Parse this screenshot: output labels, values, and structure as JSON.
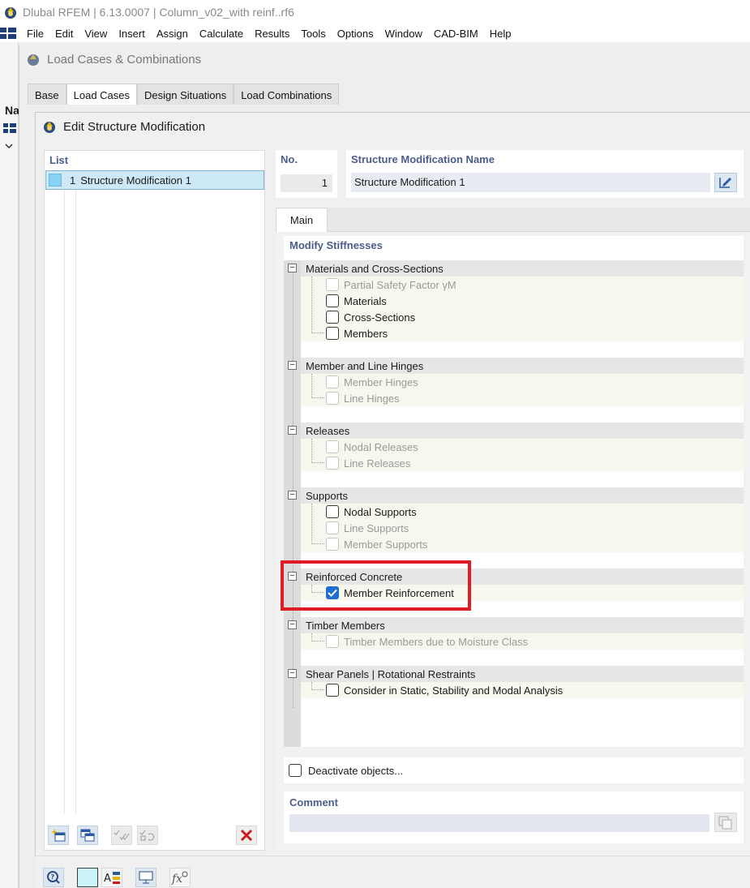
{
  "app": {
    "title": "Dlubal RFEM | 6.13.0007 | Column_v02_with reinf..rf6",
    "nav_label": "Na"
  },
  "menu": [
    "File",
    "Edit",
    "View",
    "Insert",
    "Assign",
    "Calculate",
    "Results",
    "Tools",
    "Options",
    "Window",
    "CAD-BIM",
    "Help"
  ],
  "load_cases_dialog": {
    "title": "Load Cases & Combinations",
    "tabs": [
      "Base",
      "Load Cases",
      "Design Situations",
      "Load Combinations"
    ],
    "active_tab": "Load Cases"
  },
  "edit_dialog": {
    "title": "Edit Structure Modification",
    "list_header": "List",
    "list_items": [
      {
        "num": "1",
        "label": "Structure Modification 1"
      }
    ],
    "no_header": "No.",
    "no_value": "1",
    "name_header": "Structure Modification Name",
    "name_value": "Structure Modification 1",
    "main_tab": "Main",
    "modify_header": "Modify Stiffnesses",
    "groups": [
      {
        "label": "Materials and Cross-Sections",
        "items": [
          {
            "label": "Partial Safety Factor γM",
            "enabled": false,
            "checked": false
          },
          {
            "label": "Materials",
            "enabled": true,
            "checked": false
          },
          {
            "label": "Cross-Sections",
            "enabled": true,
            "checked": false
          },
          {
            "label": "Members",
            "enabled": true,
            "checked": false
          }
        ]
      },
      {
        "label": "Member and Line Hinges",
        "items": [
          {
            "label": "Member Hinges",
            "enabled": false,
            "checked": false
          },
          {
            "label": "Line Hinges",
            "enabled": false,
            "checked": false
          }
        ]
      },
      {
        "label": "Releases",
        "items": [
          {
            "label": "Nodal Releases",
            "enabled": false,
            "checked": false
          },
          {
            "label": "Line Releases",
            "enabled": false,
            "checked": false
          }
        ]
      },
      {
        "label": "Supports",
        "items": [
          {
            "label": "Nodal Supports",
            "enabled": true,
            "checked": false
          },
          {
            "label": "Line Supports",
            "enabled": false,
            "checked": false
          },
          {
            "label": "Member Supports",
            "enabled": false,
            "checked": false
          }
        ]
      },
      {
        "label": "Reinforced Concrete",
        "items": [
          {
            "label": "Member Reinforcement",
            "enabled": true,
            "checked": true
          }
        ]
      },
      {
        "label": "Timber Members",
        "items": [
          {
            "label": "Timber Members due to Moisture Class",
            "enabled": false,
            "checked": false
          }
        ]
      },
      {
        "label": "Shear Panels | Rotational Restraints",
        "items": [
          {
            "label": "Consider in Static, Stability and Modal Analysis",
            "enabled": true,
            "checked": false
          }
        ]
      }
    ],
    "deactivate_label": "Deactivate objects...",
    "deactivate_checked": false,
    "comment_header": "Comment",
    "comment_value": ""
  },
  "colors": {
    "header_blue": "#4a5d8a",
    "highlight_red": "#e01c24",
    "check_blue": "#1f6fd0",
    "selection": "#cde8f6"
  }
}
